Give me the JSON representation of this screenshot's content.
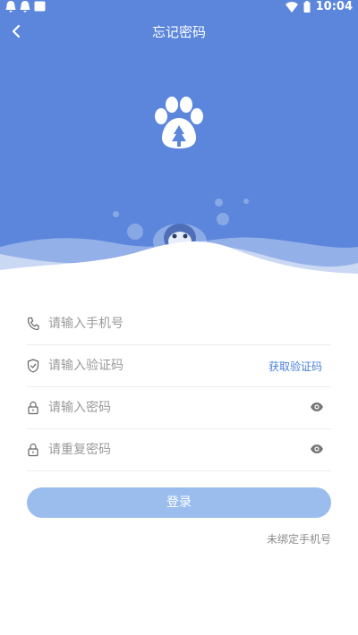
{
  "status_bar": {
    "time": "10:04"
  },
  "header": {
    "title": "忘记密码"
  },
  "colors": {
    "hero_background": "#5b86dc",
    "accent": "#4a7fd6",
    "button_background": "#9abdee"
  },
  "icons": {
    "back": "chevron-left-icon",
    "logo": "paw-logo",
    "phone": "phone-icon",
    "shield": "shield-icon",
    "lock": "lock-icon",
    "eye": "eye-icon"
  },
  "form": {
    "phone": {
      "placeholder": "请输入手机号",
      "value": ""
    },
    "code": {
      "placeholder": "请输入验证码",
      "value": "",
      "get_code_label": "获取验证码"
    },
    "password": {
      "placeholder": "请输入密码",
      "value": ""
    },
    "confirm_password": {
      "placeholder": "请重复密码",
      "value": ""
    }
  },
  "actions": {
    "login_label": "登录",
    "unbound_phone_label": "未绑定手机号"
  }
}
